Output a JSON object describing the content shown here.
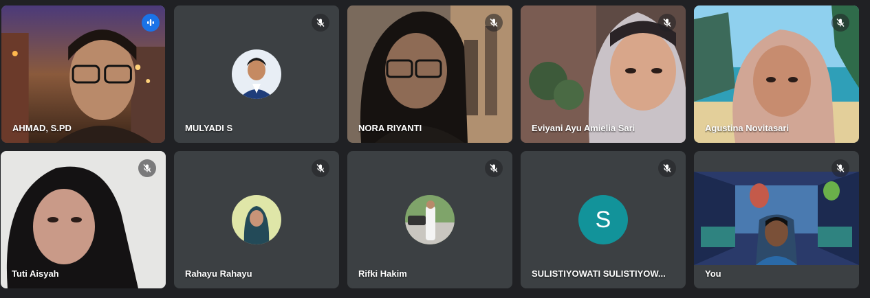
{
  "meeting": {
    "participants": [
      {
        "name": "AHMAD, S.PD",
        "speaking": true,
        "muted": false,
        "display": "video"
      },
      {
        "name": "MULYADI S",
        "muted": true,
        "display": "avatar-photo"
      },
      {
        "name": "NORA RIYANTI",
        "muted": true,
        "display": "video"
      },
      {
        "name": "Eviyani Ayu Amielia Sari",
        "muted": true,
        "display": "video"
      },
      {
        "name": "Agustina Novitasari",
        "muted": true,
        "display": "video"
      },
      {
        "name": "Tuti Aisyah",
        "muted": true,
        "display": "video"
      },
      {
        "name": "Rahayu Rahayu",
        "muted": true,
        "display": "avatar-photo"
      },
      {
        "name": "Rifki Hakim",
        "muted": true,
        "display": "avatar-photo"
      },
      {
        "name": "SULISTIYOWATI SULISTIYOW...",
        "muted": true,
        "display": "avatar-letter",
        "avatar_letter": "S"
      },
      {
        "name": "You",
        "muted": true,
        "display": "video"
      }
    ]
  },
  "icons": {
    "muted": "mic-off-icon",
    "speaking": "audio-level-icon"
  },
  "colors": {
    "background": "#202124",
    "tile": "#3c4043",
    "active_border": "#8ab4f8",
    "speaking_badge": "#1a73e8",
    "letter_avatar": "#12939a"
  }
}
